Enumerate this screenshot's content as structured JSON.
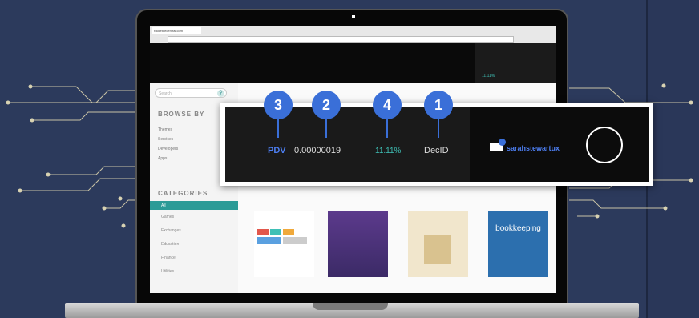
{
  "browser": {
    "tab_title": "rocketdecentral.com"
  },
  "sidebar": {
    "search_placeholder": "Search",
    "browse_heading": "BROWSE BY",
    "browse_items": [
      "Themes",
      "Services",
      "Developers",
      "Apps"
    ],
    "categories_heading": "CATEGORIES",
    "category_items": [
      "All",
      "Games",
      "Exchanges",
      "Education",
      "Finance",
      "Utilities"
    ]
  },
  "darkband": {
    "right_value": "11.11%"
  },
  "cards": {
    "card4_title": "bookkeeping"
  },
  "callout": {
    "badges": [
      "3",
      "2",
      "4",
      "1"
    ],
    "token_label": "PDV",
    "price": "0.00000019",
    "change": "11.11%",
    "id_label": "DecID",
    "username": "sarahstewartux"
  },
  "colors": {
    "accent": "#3a6fd8",
    "teal": "#3fc0b6",
    "background": "#2c3a5c"
  }
}
